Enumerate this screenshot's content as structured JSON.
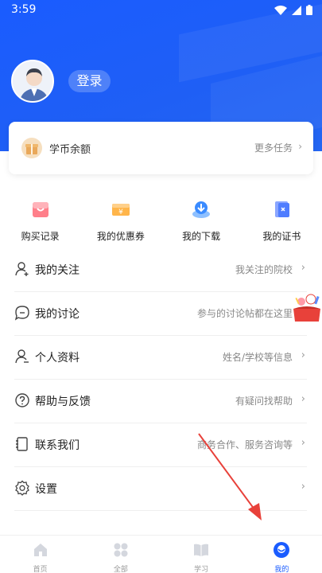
{
  "status": {
    "time": "3:59"
  },
  "profile": {
    "login_label": "登录"
  },
  "coin": {
    "label": "学币余额",
    "more_label": "更多任务"
  },
  "quick_actions": [
    {
      "label": "购买记录",
      "icon": "cart-icon"
    },
    {
      "label": "我的优惠券",
      "icon": "coupon-icon"
    },
    {
      "label": "我的下载",
      "icon": "download-icon"
    },
    {
      "label": "我的证书",
      "icon": "certificate-icon"
    }
  ],
  "menu": [
    {
      "label": "我的关注",
      "hint": "我关注的院校",
      "icon": "user-follow-icon"
    },
    {
      "label": "我的讨论",
      "hint": "参与的讨论帖都在这里",
      "icon": "chat-icon"
    },
    {
      "label": "个人资料",
      "hint": "姓名/学校等信息",
      "icon": "profile-icon"
    },
    {
      "label": "帮助与反馈",
      "hint": "有疑问找帮助",
      "icon": "help-icon"
    },
    {
      "label": "联系我们",
      "hint": "商务合作、服务咨询等",
      "icon": "phone-book-icon"
    },
    {
      "label": "设置",
      "hint": "",
      "icon": "settings-icon"
    }
  ],
  "tabs": [
    {
      "label": "首页",
      "icon": "home-icon",
      "active": false
    },
    {
      "label": "全部",
      "icon": "grid-icon",
      "active": false
    },
    {
      "label": "学习",
      "icon": "book-icon",
      "active": false
    },
    {
      "label": "我的",
      "icon": "me-icon",
      "active": true
    }
  ],
  "colors": {
    "brand": "#1a5cff",
    "accent_red": "#e8413a",
    "tab_inactive": "#999999"
  }
}
